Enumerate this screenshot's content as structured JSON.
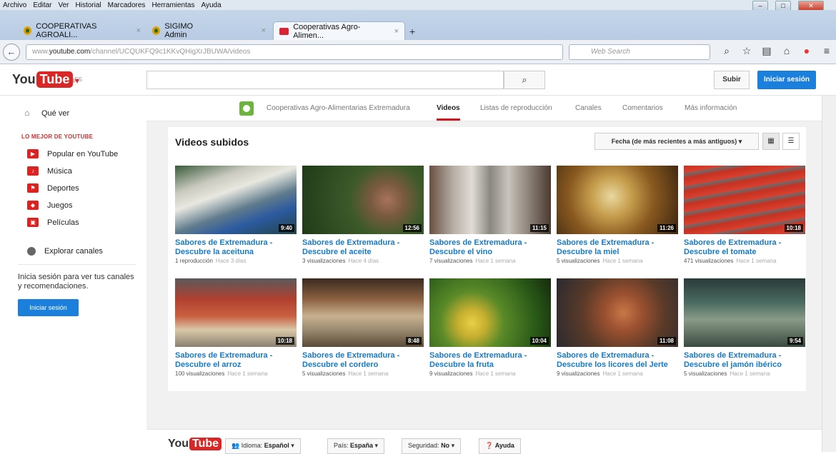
{
  "menubar": {
    "items": [
      "Archivo",
      "Editar",
      "Ver",
      "Historial",
      "Marcadores",
      "Herramientas",
      "Ayuda"
    ]
  },
  "tabs": [
    {
      "label": "COOPERATIVAS AGROALI...",
      "close": "×"
    },
    {
      "label": "SIGIMO Admin",
      "close": "×"
    },
    {
      "label": "Cooperativas Agro-Alimen...",
      "close": "×"
    }
  ],
  "newtab": "+",
  "address": {
    "prefix": "www.",
    "domain": "youtube.com",
    "path": "/channel/UCQUKFQ9c1KKvQHigXrJBUWA/videos"
  },
  "websearch": {
    "placeholder": "Web Search"
  },
  "yt": {
    "logo_you": "You",
    "logo_tube": "Tube",
    "logo_region": "ES",
    "upload": "Subir",
    "signin": "Iniciar sesión"
  },
  "sidebar": {
    "what_to_watch": "Qué ver",
    "best_of_header": "LO MEJOR DE YOUTUBE",
    "items": [
      "Popular en YouTube",
      "Música",
      "Deportes",
      "Juegos",
      "Películas"
    ],
    "explore": "Explorar canales",
    "signin_text": "Inicia sesión para ver tus canales y recomendaciones.",
    "signin_button": "Iniciar sesión"
  },
  "channel_tabs": {
    "channel_name": "Cooperativas Agro-Alimentarias Extremadura",
    "tabs": [
      "Videos",
      "Listas de reproducción",
      "Canales",
      "Comentarios",
      "Más información"
    ]
  },
  "panel": {
    "title": "Videos subidos",
    "sort": "Fecha (de más recientes a más antiguos) ▾"
  },
  "videos": [
    {
      "l1": "Sabores de Extremadura -",
      "l2": "Descubre la aceituna",
      "views": "1 reproducción",
      "age": "Hace 3 días",
      "dur": "9:40"
    },
    {
      "l1": "Sabores de Extremadura -",
      "l2": "Descubre el aceite",
      "views": "3 visualizaciones",
      "age": "Hace 4 días",
      "dur": "12:56"
    },
    {
      "l1": "Sabores de Extremadura -",
      "l2": "Descubre el vino",
      "views": "7 visualizaciones",
      "age": "Hace 1 semana",
      "dur": "11:15"
    },
    {
      "l1": "Sabores de Extremadura -",
      "l2": "Descubre la miel",
      "views": "5 visualizaciones",
      "age": "Hace 1 semana",
      "dur": "11:26"
    },
    {
      "l1": "Sabores de Extremadura -",
      "l2": "Descubre el tomate",
      "views": "471 visualizaciones",
      "age": "Hace 1 semana",
      "dur": "10:18"
    },
    {
      "l1": "Sabores de Extremadura -",
      "l2": "Descubre el arroz",
      "views": "100 visualizaciones",
      "age": "Hace 1 semana",
      "dur": "10:18"
    },
    {
      "l1": "Sabores de Extremadura -",
      "l2": "Descubre el cordero",
      "views": "5 visualizaciones",
      "age": "Hace 1 semana",
      "dur": "8:48"
    },
    {
      "l1": "Sabores de Extremadura -",
      "l2": "Descubre la fruta",
      "views": "9 visualizaciones",
      "age": "Hace 1 semana",
      "dur": "10:04"
    },
    {
      "l1": "Sabores de Extremadura -",
      "l2": "Descubre los licores del Jerte",
      "views": "9 visualizaciones",
      "age": "Hace 1 semana",
      "dur": "11:08"
    },
    {
      "l1": "Sabores de Extremadura -",
      "l2": "Descubre el jamón ibérico",
      "views": "5 visualizaciones",
      "age": "Hace 1 semana",
      "dur": "9:54"
    }
  ],
  "footer": {
    "language_label": "Idioma:",
    "language": "Español",
    "country_label": "País:",
    "country": "España",
    "safety_label": "Seguridad:",
    "safety": "No",
    "help": "Ayuda"
  },
  "colors": {
    "brand": "#d92626",
    "link": "#167ac6",
    "button": "#1b7fdc"
  }
}
